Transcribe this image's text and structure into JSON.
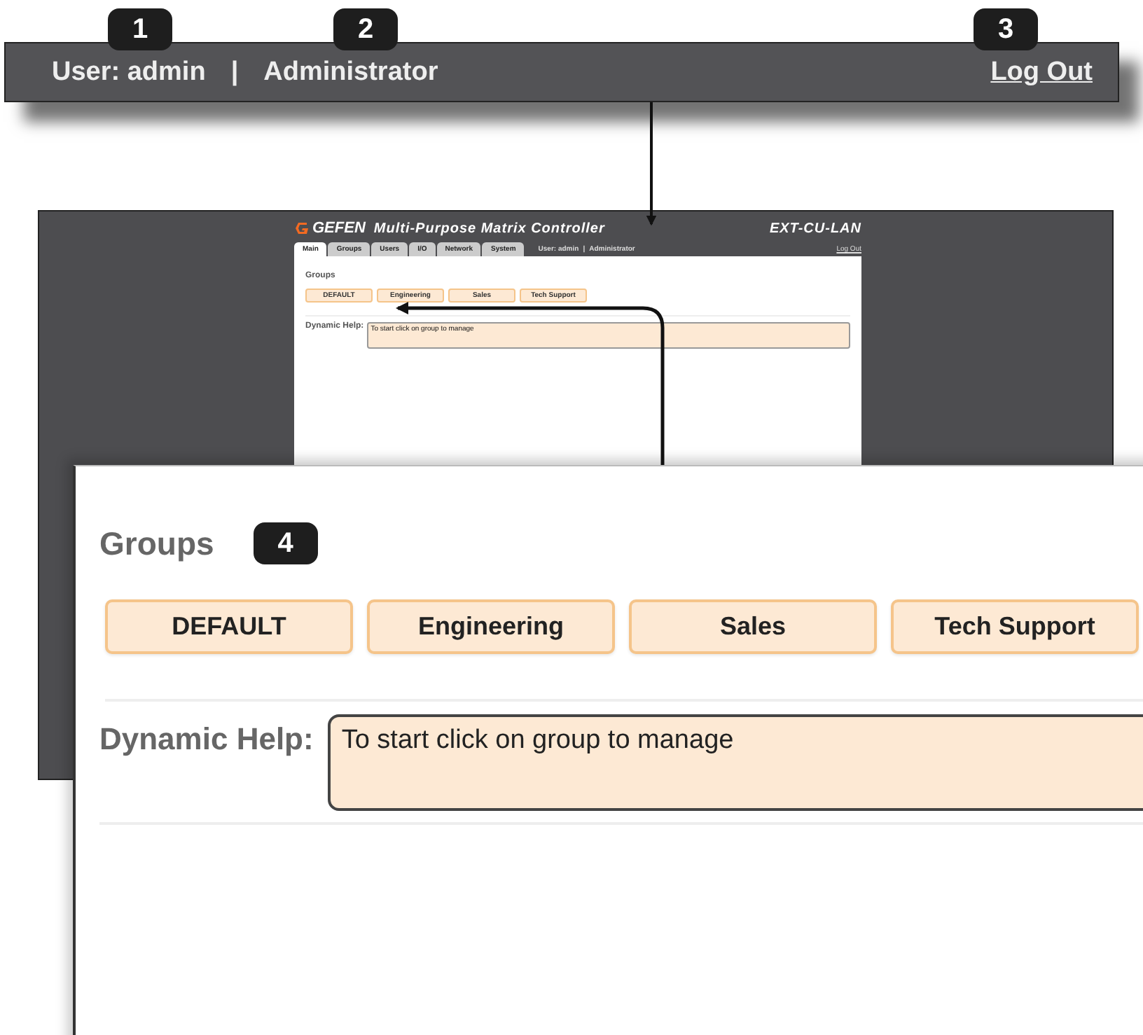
{
  "header_bar": {
    "user": "User: admin",
    "separator": "|",
    "role": "Administrator",
    "logout": "Log Out",
    "callouts": [
      "1",
      "2",
      "3"
    ]
  },
  "thumbnail": {
    "logo": "GEFEN",
    "title": "Multi-Purpose Matrix Controller",
    "model": "EXT-CU-LAN",
    "tabs": [
      {
        "label": "Main",
        "selected": true
      },
      {
        "label": "Groups",
        "selected": false
      },
      {
        "label": "Users",
        "selected": false
      },
      {
        "label": "I/O",
        "selected": false
      },
      {
        "label": "Network",
        "selected": false
      },
      {
        "label": "System",
        "selected": false
      }
    ],
    "user": "User: admin",
    "separator": "|",
    "role": "Administrator",
    "logout": "Log Out",
    "section": "Groups",
    "groups": [
      "DEFAULT",
      "Engineering",
      "Sales",
      "Tech Support"
    ],
    "help_label": "Dynamic Help:",
    "help_text": "To start click on group to manage"
  },
  "zoom_panel": {
    "section": "Groups",
    "callout": "4",
    "groups": [
      "DEFAULT",
      "Engineering",
      "Sales",
      "Tech Support"
    ],
    "help_label": "Dynamic Help:",
    "help_text": "To start click on group to manage"
  }
}
